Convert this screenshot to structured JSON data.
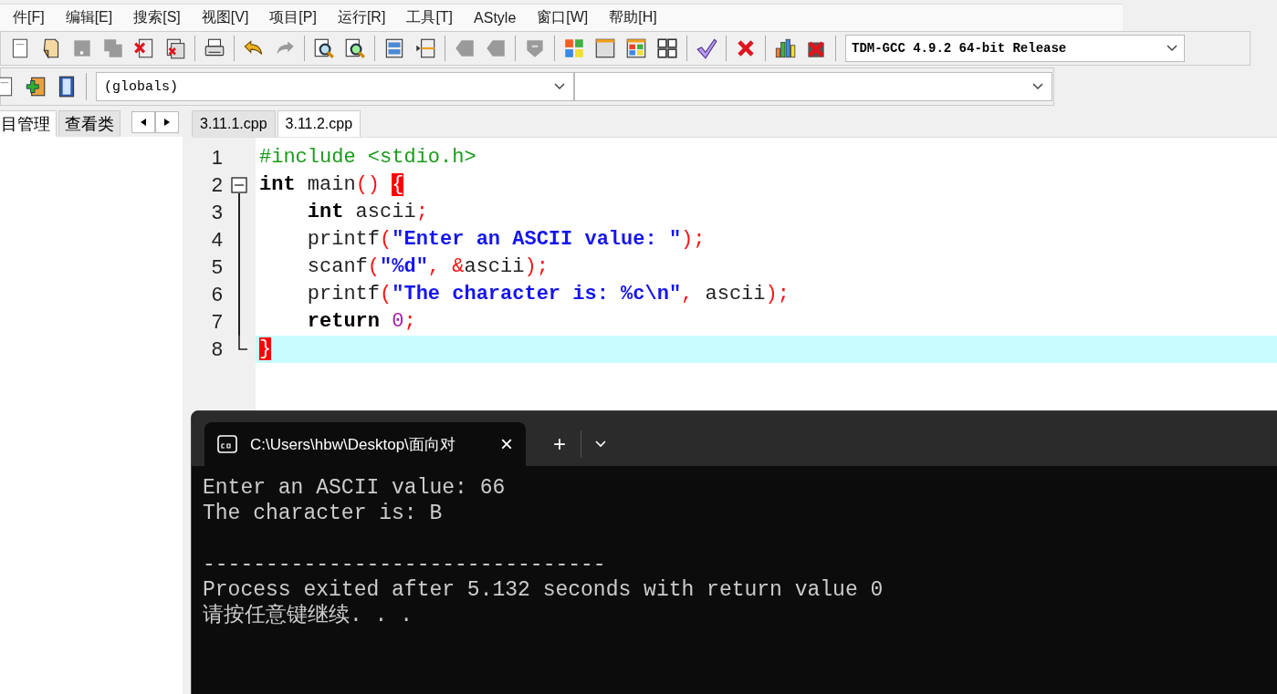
{
  "menu": [
    {
      "label": "件[F]"
    },
    {
      "label": "编辑[E]"
    },
    {
      "label": "搜索[S]"
    },
    {
      "label": "视图[V]"
    },
    {
      "label": "项目[P]"
    },
    {
      "label": "运行[R]"
    },
    {
      "label": "工具[T]"
    },
    {
      "label": "AStyle"
    },
    {
      "label": "窗口[W]"
    },
    {
      "label": "帮助[H]"
    }
  ],
  "toolbar": {
    "groups": [
      [
        {
          "kind": "page",
          "disabled": false
        },
        {
          "kind": "open",
          "disabled": false
        },
        {
          "kind": "save",
          "disabled": true
        },
        {
          "kind": "save_all",
          "disabled": true
        },
        {
          "kind": "close",
          "disabled": false
        },
        {
          "kind": "close_all",
          "disabled": false
        }
      ],
      [
        {
          "kind": "print",
          "disabled": false
        }
      ],
      [
        {
          "kind": "undo",
          "disabled": false
        },
        {
          "kind": "redo",
          "disabled": true
        }
      ],
      [
        {
          "kind": "find",
          "disabled": false
        },
        {
          "kind": "replace",
          "disabled": false
        }
      ],
      [
        {
          "kind": "panels",
          "disabled": false
        },
        {
          "kind": "split",
          "disabled": false
        }
      ],
      [
        {
          "kind": "tag",
          "disabled": true
        },
        {
          "kind": "tag",
          "disabled": true
        }
      ],
      [
        {
          "kind": "shield",
          "disabled": true
        }
      ],
      [
        {
          "kind": "color_grid",
          "disabled": false
        },
        {
          "kind": "window",
          "disabled": false
        },
        {
          "kind": "tiles",
          "disabled": false
        },
        {
          "kind": "grid",
          "disabled": false
        }
      ],
      [
        {
          "kind": "check",
          "disabled": false
        }
      ],
      [
        {
          "kind": "cross",
          "disabled": false
        }
      ],
      [
        {
          "kind": "chart",
          "disabled": false
        },
        {
          "kind": "chart_cross",
          "disabled": false
        }
      ]
    ],
    "compiler": "TDM-GCC 4.9.2 64-bit Release"
  },
  "toolbar_2": {
    "icons": [
      {
        "kind": "page",
        "disabled": false
      },
      {
        "kind": "add",
        "disabled": false
      },
      {
        "kind": "book",
        "disabled": false
      }
    ],
    "scope": "(globals)"
  },
  "side_tabs": [
    {
      "label": "目管理",
      "selected": true
    },
    {
      "label": "查看类",
      "selected": false
    }
  ],
  "file_tabs": [
    {
      "label": "3.11.1.cpp",
      "selected": false
    },
    {
      "label": "3.11.2.cpp",
      "selected": true
    }
  ],
  "code": {
    "lines": [
      {
        "number": "1",
        "tokens": [
          {
            "kind": "preprocessor",
            "text": "#include <stdio.h>"
          }
        ]
      },
      {
        "number": "2",
        "fold_start": true,
        "tokens": [
          {
            "kind": "keyword",
            "text": "int"
          },
          {
            "kind": "identifier",
            "text": " main"
          },
          {
            "kind": "symbol",
            "text": "() "
          },
          {
            "kind": "brace_match",
            "text": "{"
          }
        ]
      },
      {
        "number": "3",
        "tokens": [
          {
            "kind": "keyword",
            "text": "    int"
          },
          {
            "kind": "identifier",
            "text": " ascii"
          },
          {
            "kind": "symbol",
            "text": ";"
          }
        ]
      },
      {
        "number": "4",
        "tokens": [
          {
            "kind": "identifier",
            "text": "    printf"
          },
          {
            "kind": "symbol",
            "text": "("
          },
          {
            "kind": "string",
            "text": "\"Enter an ASCII value: \""
          },
          {
            "kind": "symbol",
            "text": ");"
          }
        ]
      },
      {
        "number": "5",
        "tokens": [
          {
            "kind": "identifier",
            "text": "    scanf"
          },
          {
            "kind": "symbol",
            "text": "("
          },
          {
            "kind": "string",
            "text": "\"%d\""
          },
          {
            "kind": "symbol",
            "text": ", &"
          },
          {
            "kind": "identifier",
            "text": "ascii"
          },
          {
            "kind": "symbol",
            "text": ");"
          }
        ]
      },
      {
        "number": "6",
        "tokens": [
          {
            "kind": "identifier",
            "text": "    printf"
          },
          {
            "kind": "symbol",
            "text": "("
          },
          {
            "kind": "string",
            "text": "\"The character is: %c\\n\""
          },
          {
            "kind": "symbol",
            "text": ","
          },
          {
            "kind": "identifier",
            "text": " ascii"
          },
          {
            "kind": "symbol",
            "text": ");"
          }
        ]
      },
      {
        "number": "7",
        "tokens": [
          {
            "kind": "keyword",
            "text": "    return "
          },
          {
            "kind": "number",
            "text": "0"
          },
          {
            "kind": "symbol",
            "text": ";"
          }
        ]
      },
      {
        "number": "8",
        "fold_end": true,
        "current": true,
        "tokens": [
          {
            "kind": "brace_match",
            "text": "}"
          }
        ]
      }
    ]
  },
  "console": {
    "title": "C:\\Users\\hbw\\Desktop\\面向对",
    "close": "×",
    "new_tab": "+",
    "lines": [
      {
        "text": "Enter an ASCII value: 66"
      },
      {
        "text": "The character is: B"
      },
      {
        "text": "--------------------------------",
        "blank_before": true
      },
      {
        "text": "Process exited after 5.132 seconds with return value 0"
      },
      {
        "text": "请按任意键继续. . ."
      }
    ]
  }
}
